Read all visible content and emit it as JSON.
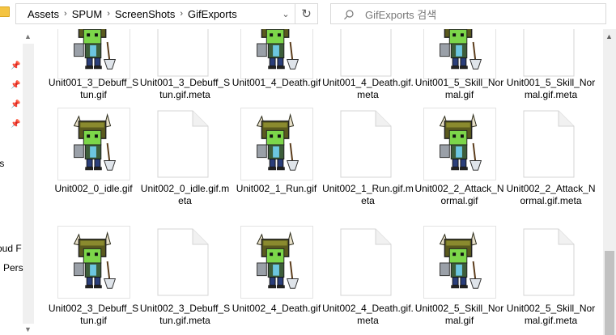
{
  "breadcrumb": [
    "Assets",
    "SPUM",
    "ScreenShots",
    "GifExports"
  ],
  "search": {
    "placeholder": "GifExports 검색"
  },
  "nav": {
    "labels": [
      "ts",
      "oud F",
      "Pers"
    ]
  },
  "files": [
    {
      "name": "Unit001_3_Debuff_Stun.gif",
      "kind": "gif"
    },
    {
      "name": "Unit001_3_Debuff_Stun.gif.meta",
      "kind": "meta"
    },
    {
      "name": "Unit001_4_Death.gif",
      "kind": "gif"
    },
    {
      "name": "Unit001_4_Death.gif.meta",
      "kind": "meta"
    },
    {
      "name": "Unit001_5_Skill_Normal.gif",
      "kind": "gif"
    },
    {
      "name": "Unit001_5_Skill_Normal.gif.meta",
      "kind": "meta"
    },
    {
      "name": "Unit002_0_idle.gif",
      "kind": "gif"
    },
    {
      "name": "Unit002_0_idle.gif.meta",
      "kind": "meta"
    },
    {
      "name": "Unit002_1_Run.gif",
      "kind": "gif"
    },
    {
      "name": "Unit002_1_Run.gif.meta",
      "kind": "meta"
    },
    {
      "name": "Unit002_2_Attack_Normal.gif",
      "kind": "gif"
    },
    {
      "name": "Unit002_2_Attack_Normal.gif.meta",
      "kind": "meta"
    },
    {
      "name": "Unit002_3_Debuff_Stun.gif",
      "kind": "gif"
    },
    {
      "name": "Unit002_3_Debuff_Stun.gif.meta",
      "kind": "meta"
    },
    {
      "name": "Unit002_4_Death.gif",
      "kind": "gif"
    },
    {
      "name": "Unit002_4_Death.gif.meta",
      "kind": "meta"
    },
    {
      "name": "Unit002_5_Skill_Normal.gif",
      "kind": "gif"
    },
    {
      "name": "Unit002_5_Skill_Normal.gif.meta",
      "kind": "meta"
    }
  ],
  "icons": {
    "folder": "folder-icon",
    "search": "search-icon",
    "refresh": "refresh-icon",
    "pin": "pin-icon",
    "dropdown": "chevron-down-icon",
    "meta": "document-icon",
    "gif": "character-sprite-thumbnail"
  }
}
